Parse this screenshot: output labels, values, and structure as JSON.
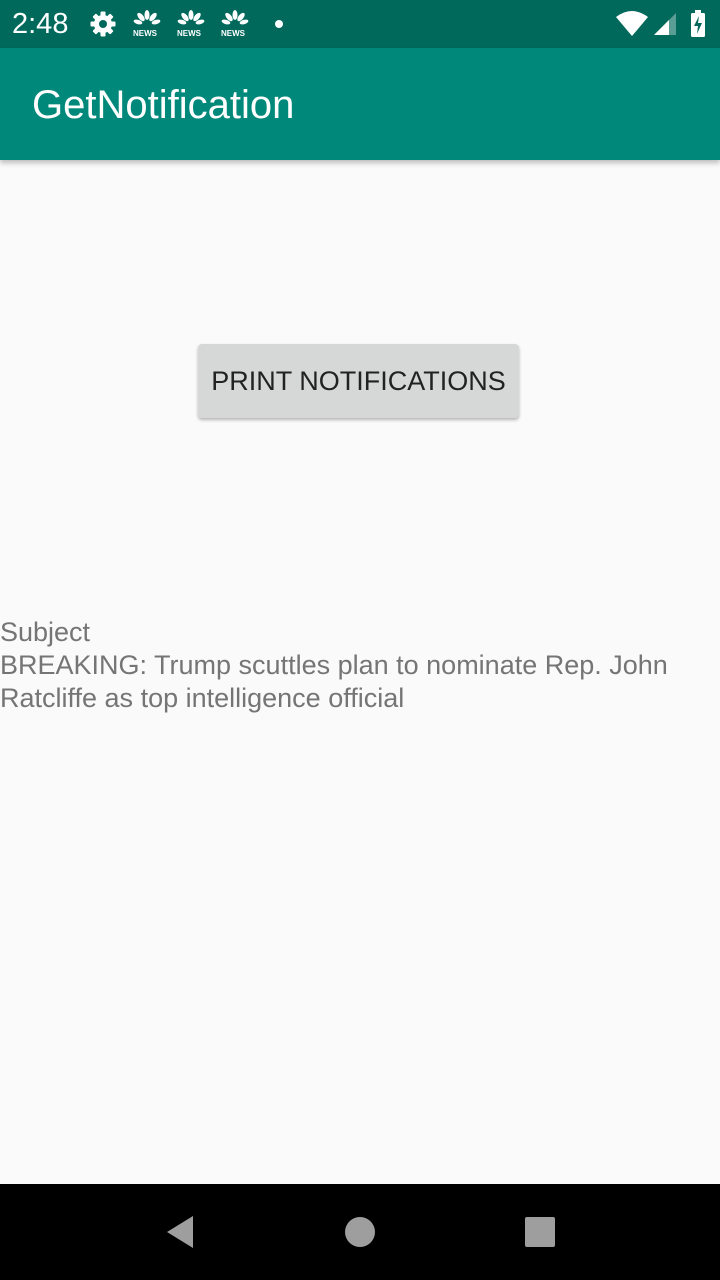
{
  "status_bar": {
    "time": "2:48",
    "news_label": "NEWS",
    "icons": [
      "gear-icon",
      "nbc-news-icon",
      "nbc-news-icon",
      "nbc-news-icon",
      "notification-dot-icon",
      "wifi-icon",
      "signal-icon",
      "battery-icon"
    ]
  },
  "app_bar": {
    "title": "GetNotification"
  },
  "main": {
    "print_button_label": "PRINT NOTIFICATIONS",
    "subject_label": "Subject",
    "notification_line1": "BREAKING: Trump scuttles plan to nominate Rep. John",
    "notification_line2": "Ratcliffe as top intelligence official"
  },
  "nav_bar": {
    "icons": [
      "back-icon",
      "home-icon",
      "recents-icon"
    ]
  },
  "colors": {
    "status_bar": "#00695c",
    "app_bar": "#00897b",
    "background": "#fafafa",
    "button": "#d6d7d7",
    "body_text": "#757575"
  }
}
